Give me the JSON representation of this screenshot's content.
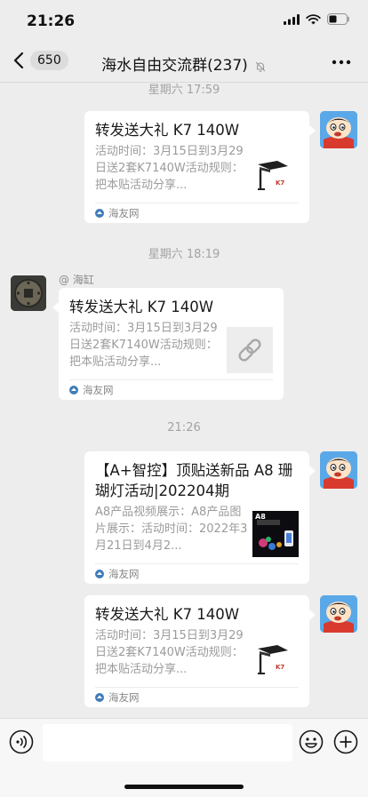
{
  "status_bar": {
    "time": "21:26"
  },
  "nav": {
    "unread_count": "650",
    "title": "海水自由交流群(237)"
  },
  "messages": [
    {
      "type": "timestamp",
      "text": "星期六 17:59"
    },
    {
      "type": "link_card",
      "side": "right",
      "title": "转发送大礼  K7 140W",
      "desc": "活动时间：3月15日到3月29日送2套K7140W活动规则：把本贴活动分享...",
      "source": "海友网",
      "thumb": "lamp-k7-image"
    },
    {
      "type": "timestamp",
      "text": "星期六 18:19"
    },
    {
      "type": "link_card",
      "side": "left",
      "sender": "@ 海缸",
      "title": "转发送大礼  K7 140W",
      "desc": "活动时间：3月15日到3月29日送2套K7140W活动规则：把本贴活动分享...",
      "source": "海友网",
      "thumb": "link-icon"
    },
    {
      "type": "timestamp",
      "text": "21:26"
    },
    {
      "type": "link_card",
      "side": "right",
      "title": "【A+智控】顶贴送新品 A8 珊瑚灯活动|202204期",
      "desc": "A8产品视频展示：A8产品图片展示：活动时间：2022年3月21日到4月2...",
      "source": "海友网",
      "thumb": "a8-product-image",
      "thumb_label": "A8"
    },
    {
      "type": "link_card",
      "side": "right",
      "title": "转发送大礼  K7 140W",
      "desc": "活动时间：3月15日到3月29日送2套K7140W活动规则：把本贴活动分享...",
      "source": "海友网",
      "thumb": "lamp-k7-image"
    }
  ],
  "colors": {
    "background": "#ededed",
    "bubble": "#ffffff",
    "secondary_text": "#9b9b9b",
    "timestamp_text": "#a3a3a3"
  }
}
